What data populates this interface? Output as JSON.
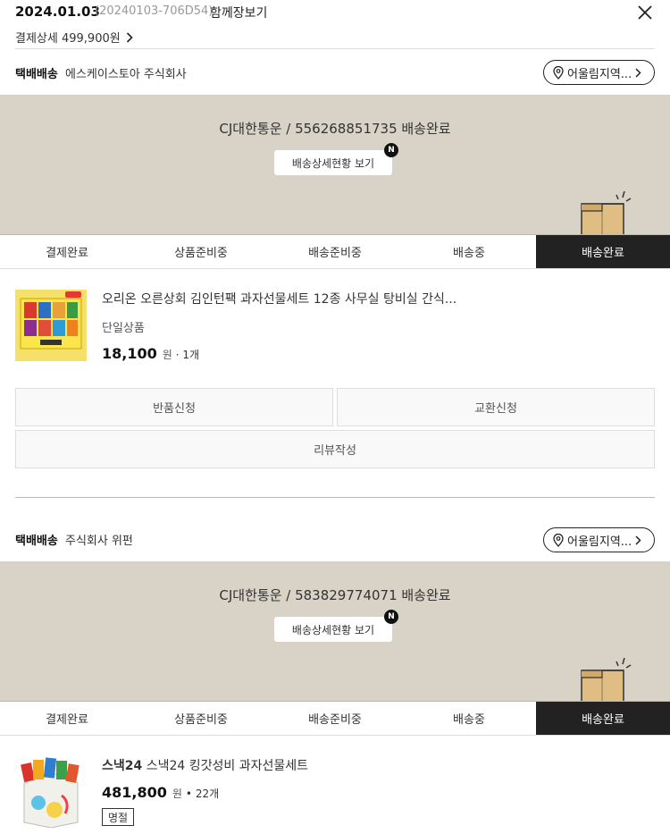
{
  "header": {
    "date": "2024.01.03",
    "order_no": "(20240103-706D54)",
    "cart_link": "함께장보기",
    "payment_detail": "결제상세 499,900원"
  },
  "shipments": [
    {
      "method": "택배배송",
      "seller": "에스케이스토아 주식회사",
      "location_button": "어울림지역...",
      "tracking": "CJ대한통운 / 556268851735 배송완료",
      "tracking_button": "배송상세현황 보기",
      "badge": "N",
      "steps": [
        "결제완료",
        "상품준비중",
        "배송준비중",
        "배송중",
        "배송완료"
      ],
      "active_step": 4,
      "product": {
        "name": "오리온 오른상회 김인턴팩 과자선물세트 12종 사무실 탕비실 간식...",
        "option": "단일상품",
        "price": "18,100",
        "won": "원",
        "qty": "· 1개"
      },
      "actions": [
        "반품신청",
        "교환신청",
        "리뷰작성"
      ]
    },
    {
      "method": "택배배송",
      "seller": "주식회사 위펀",
      "location_button": "어울림지역...",
      "tracking": "CJ대한통운 / 583829774071 배송완료",
      "tracking_button": "배송상세현황 보기",
      "badge": "N",
      "steps": [
        "결제완료",
        "상품준비중",
        "배송준비중",
        "배송중",
        "배송완료"
      ],
      "active_step": 4,
      "product": {
        "brand": "스낵24",
        "name": "스낵24 킹갓성비 과자선물세트",
        "price": "481,800",
        "won": "원",
        "qty": "• 22개",
        "tag": "명절"
      }
    }
  ],
  "icons": [
    "close-icon",
    "chevron-right-icon",
    "location-pin-icon",
    "delivery-box-icon"
  ],
  "colors": {
    "track_bg": "#d8d3c6",
    "active_step_bg": "#222222"
  }
}
